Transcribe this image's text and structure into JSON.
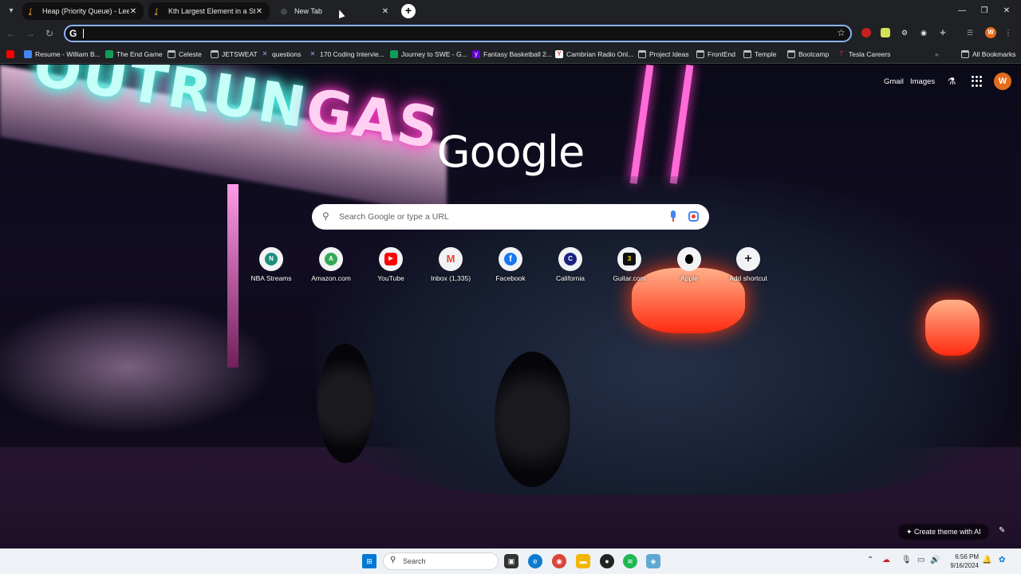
{
  "tabs": [
    {
      "title": "Heap (Priority Queue) - LeetCode"
    },
    {
      "title": "Kth Largest Element in a Stream"
    },
    {
      "title": "New Tab"
    }
  ],
  "omnibox": {
    "value": "",
    "placeholder": ""
  },
  "bookmarks": [
    {
      "label": "Resume - William B..."
    },
    {
      "label": "The End Game"
    },
    {
      "label": "Celeste"
    },
    {
      "label": "JETSWEAT"
    },
    {
      "label": "questions"
    },
    {
      "label": "170 Coding Intervie..."
    },
    {
      "label": "Journey to SWE - G..."
    },
    {
      "label": "Fantasy Basketball 2..."
    },
    {
      "label": "Cambrian Radio Onl..."
    },
    {
      "label": "Project Ideas"
    },
    {
      "label": "FrontEnd"
    },
    {
      "label": "Temple"
    },
    {
      "label": "Bootcamp"
    },
    {
      "label": "Tesla Careers"
    }
  ],
  "all_bookmarks": "All Bookmarks",
  "header": {
    "gmail": "Gmail",
    "images": "Images",
    "avatar_letter": "W"
  },
  "logo": "Google",
  "search": {
    "placeholder": "Search Google or type a URL"
  },
  "shortcuts": [
    {
      "label": "NBA Streams",
      "glyph": "N",
      "color": "#1e8e7e"
    },
    {
      "label": "Amazon.com",
      "glyph": "A",
      "color": "#34a853"
    },
    {
      "label": "YouTube",
      "glyph": "▶",
      "color": "#ff0000"
    },
    {
      "label": "Inbox (1,335)",
      "glyph": "M",
      "color": "#ea4335"
    },
    {
      "label": "Facebook",
      "glyph": "f",
      "color": "#1877f2"
    },
    {
      "label": "California",
      "glyph": "C",
      "color": "#1a237e"
    },
    {
      "label": "Guitar.com",
      "glyph": "3",
      "color": "#111111"
    },
    {
      "label": "Apple",
      "glyph": "",
      "color": "#000000"
    },
    {
      "label": "Add shortcut",
      "glyph": "+",
      "color": "#202124"
    }
  ],
  "create_theme": "Create theme with AI",
  "taskbar": {
    "search": "Search",
    "time": "6:56 PM",
    "date": "9/16/2024"
  }
}
